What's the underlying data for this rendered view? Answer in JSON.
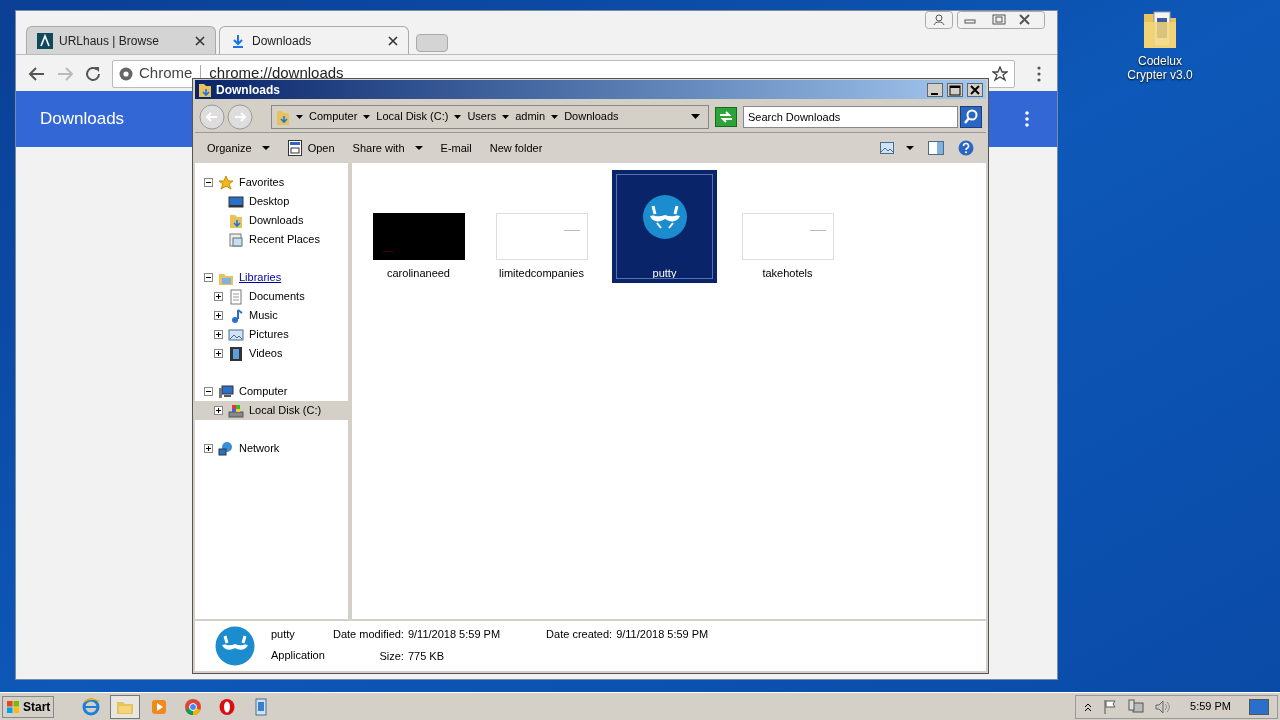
{
  "desktop_icons": [
    {
      "label": "Codelux Crypter v3.0"
    }
  ],
  "browser": {
    "tabs": [
      {
        "title": "URLhaus | Browse",
        "kind": "site",
        "selected": false
      },
      {
        "title": "Downloads",
        "kind": "download",
        "selected": true
      }
    ],
    "omnibox": {
      "site_label": "Chrome",
      "url": "chrome://downloads"
    },
    "page_header": "Downloads"
  },
  "explorer": {
    "title": "Downloads",
    "breadcrumbs": [
      "Computer",
      "Local Disk (C:)",
      "Users",
      "admin",
      "Downloads"
    ],
    "search": {
      "placeholder": "Search Downloads"
    },
    "commands": [
      {
        "label": "Organize",
        "kind": "menu"
      },
      {
        "label": "Open",
        "kind": "icon-button"
      },
      {
        "label": "Share with",
        "kind": "menu"
      },
      {
        "label": "E-mail",
        "kind": "button"
      },
      {
        "label": "New folder",
        "kind": "button"
      }
    ],
    "nav": [
      {
        "label": "Favorites",
        "kind": "star",
        "expanded": true,
        "selected": false,
        "hovered": false,
        "children": [
          {
            "label": "Desktop",
            "kind": "desktop",
            "selected": false,
            "hovered": false
          },
          {
            "label": "Downloads",
            "kind": "downloads",
            "selected": false,
            "hovered": false
          },
          {
            "label": "Recent Places",
            "kind": "recent",
            "selected": false,
            "hovered": false
          }
        ]
      },
      {
        "label": "Libraries",
        "kind": "libraries",
        "expanded": true,
        "selected": false,
        "hovered": true,
        "children": [
          {
            "label": "Documents",
            "kind": "documents",
            "expanded": false,
            "selected": false,
            "hovered": false
          },
          {
            "label": "Music",
            "kind": "music",
            "expanded": false,
            "selected": false,
            "hovered": false
          },
          {
            "label": "Pictures",
            "kind": "pictures",
            "expanded": false,
            "selected": false,
            "hovered": false
          },
          {
            "label": "Videos",
            "kind": "videos",
            "expanded": false,
            "selected": false,
            "hovered": false
          }
        ]
      },
      {
        "label": "Computer",
        "kind": "computer",
        "expanded": true,
        "selected": false,
        "hovered": false,
        "children": [
          {
            "label": "Local Disk (C:)",
            "kind": "disk",
            "expanded": false,
            "selected": true,
            "hovered": false
          }
        ]
      },
      {
        "label": "Network",
        "kind": "network",
        "expanded": false,
        "selected": false,
        "hovered": false
      }
    ],
    "files": [
      {
        "name": "carolinaneed",
        "kind": "dark-image",
        "selected": false
      },
      {
        "name": "limitedcompanies",
        "kind": "light-image",
        "selected": false
      },
      {
        "name": "putty",
        "kind": "app",
        "selected": true
      },
      {
        "name": "takehotels",
        "kind": "light-image",
        "selected": false
      }
    ],
    "details": {
      "name": "putty",
      "type": "Application",
      "fields": [
        {
          "label": "Date modified:",
          "value": "9/11/2018 5:59 PM"
        },
        {
          "label": "Date created:",
          "value": "9/11/2018 5:59 PM"
        },
        {
          "label": "Size:",
          "value": "775 KB"
        }
      ]
    }
  },
  "taskbar": {
    "start": "Start",
    "apps": [
      {
        "kind": "ie",
        "selected": false
      },
      {
        "kind": "explorer",
        "selected": true
      },
      {
        "kind": "media",
        "selected": false
      },
      {
        "kind": "chrome",
        "selected": false
      },
      {
        "kind": "opera",
        "selected": false
      },
      {
        "kind": "app",
        "selected": false
      }
    ],
    "clock": "5:59 PM"
  }
}
